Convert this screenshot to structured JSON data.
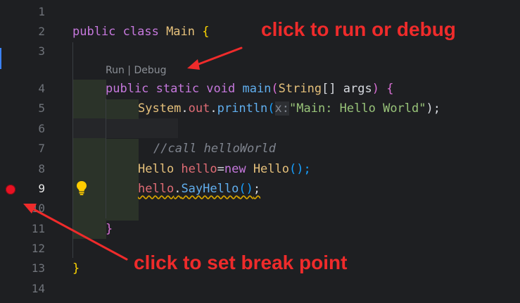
{
  "line_numbers": [
    "1",
    "2",
    "3",
    "4",
    "5",
    "6",
    "7",
    "8",
    "9",
    "10",
    "11",
    "12",
    "13",
    "14"
  ],
  "active_line": "9",
  "codelens": {
    "run": "Run",
    "separator": " | ",
    "debug": "Debug"
  },
  "code": {
    "l2": {
      "kw": "public class ",
      "cls": "Main",
      "brace": " {"
    },
    "l4": {
      "kw": "public static void ",
      "fn": "main",
      "p1": "(",
      "type": "String",
      "arr": "[] args",
      "p2": ") ",
      "brace": "{"
    },
    "l5": {
      "obj": "System",
      "dot1": ".",
      "field": "out",
      "dot2": ".",
      "method": "println",
      "paren1": "(",
      "hint": "x:",
      "str": "\"Main: Hello World\"",
      "end": ");"
    },
    "l7": {
      "comment": "//call helloWorld"
    },
    "l8": {
      "cls": "Hello ",
      "var": "hello",
      "eq": "=",
      "kw": "new ",
      "ctor": "Hello",
      "end": "();"
    },
    "l9": {
      "var": "hello",
      "dot": ".",
      "method": "SayHello",
      "paren": "()",
      "end": ";"
    },
    "l11": {
      "brace": "}"
    },
    "l13": {
      "brace": "}"
    }
  },
  "annotations": {
    "run_debug": "click to run or debug",
    "breakpoint": "click to set break point"
  },
  "colors": {
    "background": "#1e1f22",
    "breakpoint": "#e81123",
    "annotation": "#ef2b2b",
    "keyword": "#c678dd",
    "class": "#e5c07b",
    "function": "#61afef",
    "string": "#98c379"
  },
  "icons": {
    "breakpoint": "breakpoint-dot-icon",
    "lightbulb": "lightbulb-icon"
  }
}
